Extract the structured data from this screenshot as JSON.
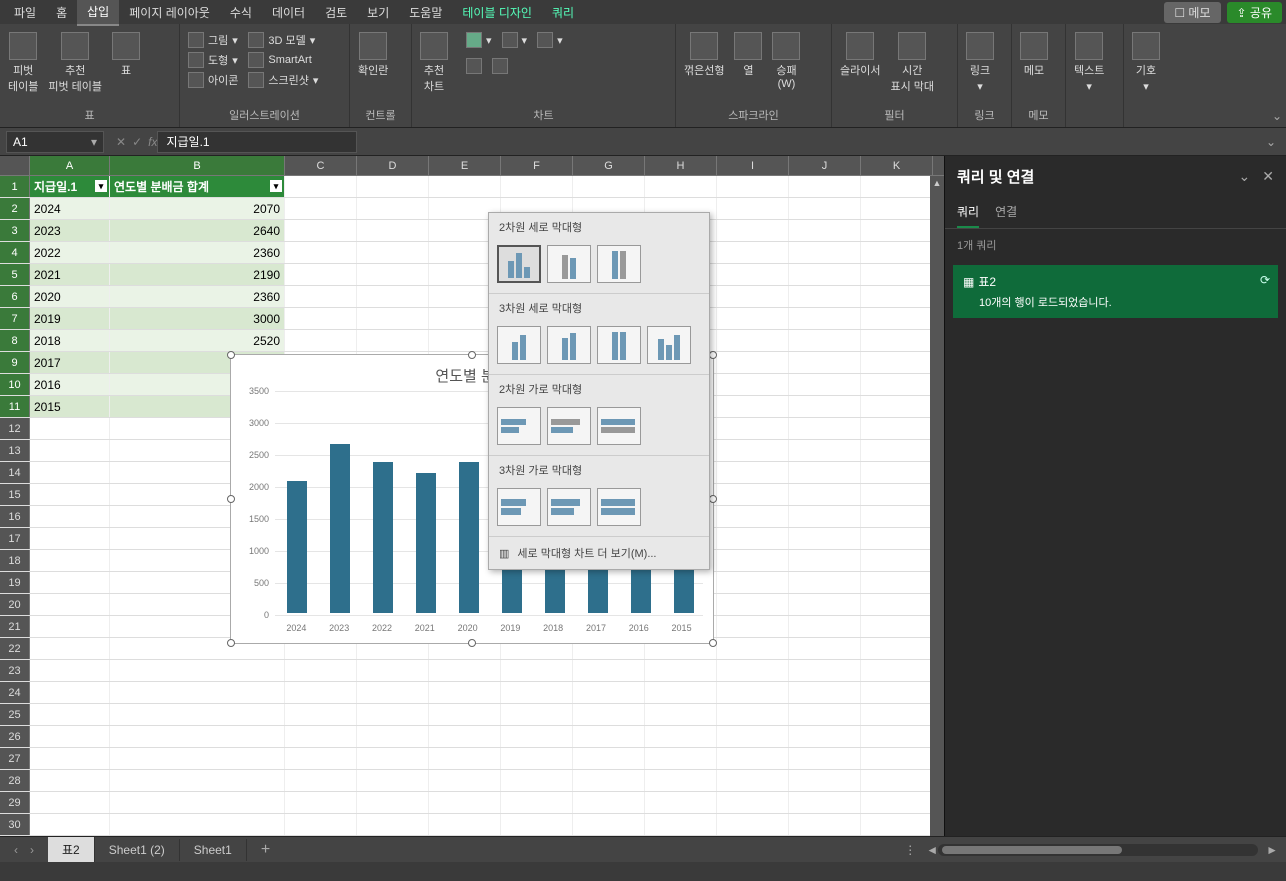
{
  "menubar": {
    "tabs": [
      "파일",
      "홈",
      "삽입",
      "페이지 레이아웃",
      "수식",
      "데이터",
      "검토",
      "보기",
      "도움말",
      "테이블 디자인",
      "쿼리"
    ],
    "active_index": 2,
    "memo": "메모",
    "share": "공유"
  },
  "ribbon": {
    "groups": {
      "tables": {
        "label": "표",
        "pivot": "피벗\n테이블",
        "rec_pivot": "추천\n피벗 테이블",
        "table": "표"
      },
      "illust": {
        "label": "일러스트레이션",
        "picture": "그림",
        "model3d": "3D 모델",
        "shapes": "도형",
        "smartart": "SmartArt",
        "icons": "아이콘",
        "screenshot": "스크린샷"
      },
      "controls": {
        "label": "컨트롤",
        "checkbox": "확인란"
      },
      "charts": {
        "label": "차트",
        "rec_chart": "추천\n차트"
      },
      "sparklines": {
        "label": "스파크라인",
        "line": "꺾은선형",
        "column": "열",
        "winloss": "승패\n(W)"
      },
      "filters": {
        "label": "필터",
        "slicer": "슬라이서",
        "timeline": "시간\n표시 막대"
      },
      "links": {
        "label": "링크",
        "link": "링크"
      },
      "memo": {
        "label": "메모",
        "memo": "메모"
      },
      "text": {
        "label": "텍스트",
        "text": "텍스트"
      },
      "symbols": {
        "label": "기호",
        "symbol": "기호"
      }
    }
  },
  "formula_bar": {
    "name_box": "A1",
    "fx_label": "fx",
    "value": "지급일.1"
  },
  "columns": [
    "A",
    "B",
    "C",
    "D",
    "E",
    "F",
    "G",
    "H",
    "I",
    "J",
    "K"
  ],
  "table": {
    "header_a": "지급일.1",
    "header_b": "연도별 분배금 합계",
    "rows": [
      {
        "year": "2024",
        "val": "2070"
      },
      {
        "year": "2023",
        "val": "2640"
      },
      {
        "year": "2022",
        "val": "2360"
      },
      {
        "year": "2021",
        "val": "2190"
      },
      {
        "year": "2020",
        "val": "2360"
      },
      {
        "year": "2019",
        "val": "3000"
      },
      {
        "year": "2018",
        "val": "2520"
      },
      {
        "year": "2017",
        "val": ""
      },
      {
        "year": "2016",
        "val": ""
      },
      {
        "year": "2015",
        "val": ""
      }
    ]
  },
  "chart_dropdown": {
    "sect1": "2차원 세로 막대형",
    "sect2": "3차원 세로 막대형",
    "sect3": "2차원 가로 막대형",
    "sect4": "3차원 가로 막대형",
    "more": "세로 막대형 차트 더 보기(M)..."
  },
  "chart_data": {
    "type": "bar",
    "title": "연도별 분배",
    "categories": [
      "2024",
      "2023",
      "2022",
      "2021",
      "2020",
      "2019",
      "2018",
      "2017",
      "2016",
      "2015"
    ],
    "values": [
      2070,
      2640,
      2360,
      2190,
      2360,
      3000,
      2520,
      2360,
      2280,
      2120
    ],
    "ylim": [
      0,
      3500
    ],
    "yticks": [
      0,
      500,
      1000,
      1500,
      2000,
      2500,
      3000,
      3500
    ],
    "xlabel": "",
    "ylabel": ""
  },
  "side_panel": {
    "title": "쿼리 및 연결",
    "tab_query": "쿼리",
    "tab_conn": "연결",
    "info": "1개 쿼리",
    "query_name": "표2",
    "query_status": "10개의 행이 로드되었습니다."
  },
  "sheet_tabs": {
    "tabs": [
      "표2",
      "Sheet1 (2)",
      "Sheet1"
    ],
    "active_index": 0
  }
}
